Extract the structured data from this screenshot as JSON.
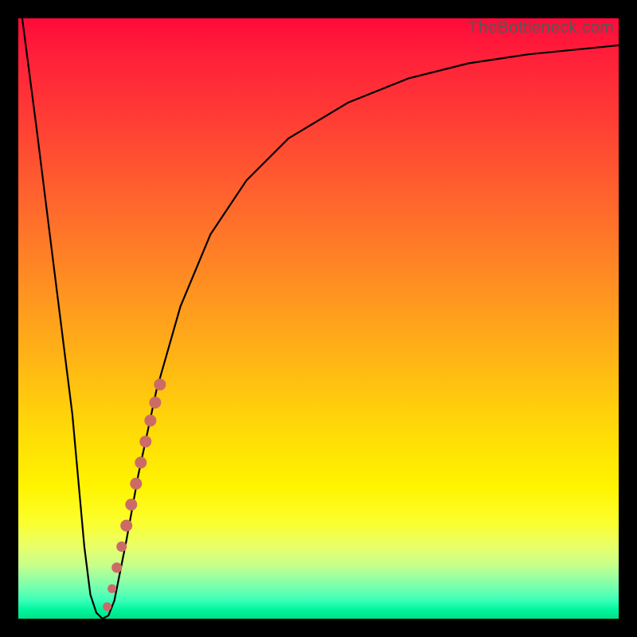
{
  "watermark": "TheBottleneck.com",
  "colors": {
    "line": "#000000",
    "marker": "#cc6b66",
    "marker_stroke": "#cc6b66"
  },
  "chart_data": {
    "type": "line",
    "title": "",
    "xlabel": "",
    "ylabel": "",
    "xlim": [
      0,
      100
    ],
    "ylim": [
      0,
      100
    ],
    "series": [
      {
        "name": "bottleneck-curve",
        "x": [
          0,
          3,
          6,
          9,
          11,
          12,
          13,
          14,
          15,
          16,
          18,
          20,
          23,
          27,
          32,
          38,
          45,
          55,
          65,
          75,
          85,
          95,
          100
        ],
        "y": [
          105,
          82,
          58,
          34,
          12,
          4,
          1,
          0,
          0.5,
          3,
          13,
          24,
          38,
          52,
          64,
          73,
          80,
          86,
          90,
          92.5,
          94,
          95,
          95.5
        ]
      }
    ],
    "markers": {
      "name": "highlight-segment",
      "points": [
        {
          "x": 14.8,
          "y": 2.0,
          "r": 5
        },
        {
          "x": 15.6,
          "y": 5.0,
          "r": 5
        },
        {
          "x": 16.4,
          "y": 8.5,
          "r": 6
        },
        {
          "x": 17.2,
          "y": 12.0,
          "r": 6
        },
        {
          "x": 18.0,
          "y": 15.5,
          "r": 7
        },
        {
          "x": 18.8,
          "y": 19.0,
          "r": 7
        },
        {
          "x": 19.6,
          "y": 22.5,
          "r": 7
        },
        {
          "x": 20.4,
          "y": 26.0,
          "r": 7
        },
        {
          "x": 21.2,
          "y": 29.5,
          "r": 7
        },
        {
          "x": 22.0,
          "y": 33.0,
          "r": 7
        },
        {
          "x": 22.8,
          "y": 36.0,
          "r": 7
        },
        {
          "x": 23.6,
          "y": 39.0,
          "r": 7
        }
      ]
    }
  }
}
